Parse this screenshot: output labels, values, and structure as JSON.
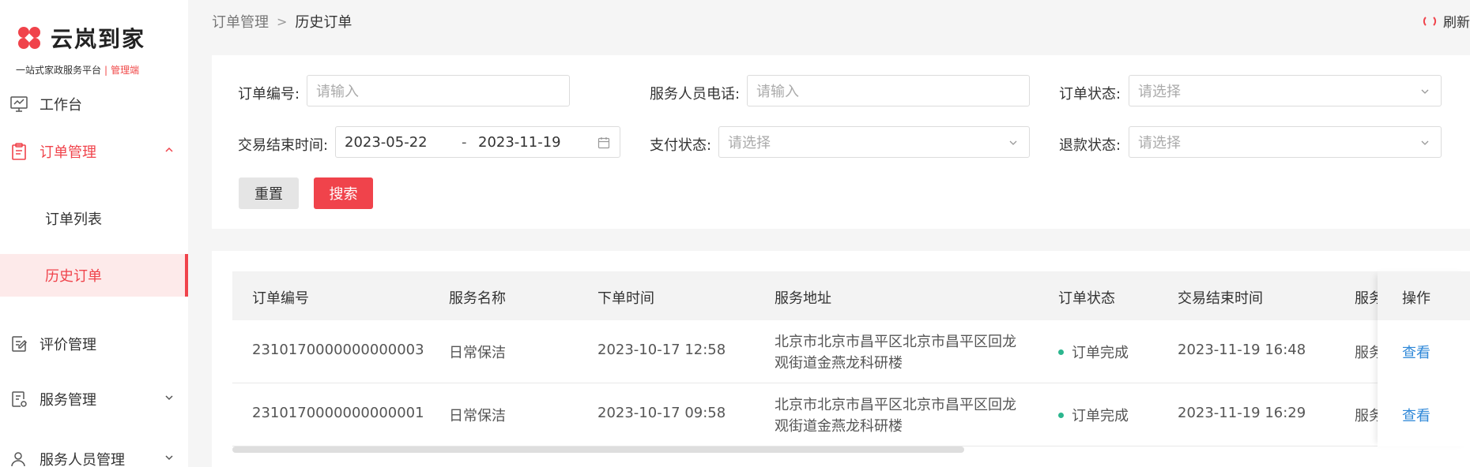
{
  "brand": {
    "name": "云岚到家",
    "tagline": "一站式家政服务平台",
    "separator": "|",
    "role": "管理端",
    "accent": "#f0434b"
  },
  "sidebar": {
    "items": [
      {
        "label": "工作台",
        "icon": "monitor-icon"
      },
      {
        "label": "订单管理",
        "icon": "clipboard-icon",
        "expanded": true
      },
      {
        "label": "订单列表"
      },
      {
        "label": "历史订单",
        "selected": true
      },
      {
        "label": "评价管理",
        "icon": "edit-doc-icon"
      },
      {
        "label": "服务管理",
        "icon": "settings-doc-icon"
      },
      {
        "label": "服务人员管理",
        "icon": "person-icon"
      }
    ]
  },
  "breadcrumb": {
    "parent": "订单管理",
    "separator": ">",
    "current": "历史订单"
  },
  "refresh_label": "刷新",
  "filters": {
    "order_no": {
      "label": "订单编号:",
      "placeholder": "请输入"
    },
    "staff_phone": {
      "label": "服务人员电话:",
      "placeholder": "请输入"
    },
    "order_status": {
      "label": "订单状态:",
      "placeholder": "请选择"
    },
    "trade_end_time": {
      "label": "交易结束时间:",
      "start": "2023-05-22",
      "separator": "-",
      "end": "2023-11-19"
    },
    "pay_status": {
      "label": "支付状态:",
      "placeholder": "请选择"
    },
    "refund_status": {
      "label": "退款状态:",
      "placeholder": "请选择"
    },
    "reset_label": "重置",
    "search_label": "搜索"
  },
  "table": {
    "columns": [
      "订单编号",
      "服务名称",
      "下单时间",
      "服务地址",
      "订单状态",
      "交易结束时间",
      "服务",
      "操作"
    ],
    "rows": [
      {
        "order_no": "2310170000000000003",
        "service_name": "日常保洁",
        "order_time": "2023-10-17 12:58",
        "address": "北京市北京市昌平区北京市昌平区回龙观街道金燕龙科研楼",
        "status": "订单完成",
        "end_time": "2023-11-19 16:48",
        "service_clip": "服务",
        "action": "查看"
      },
      {
        "order_no": "2310170000000000001",
        "service_name": "日常保洁",
        "order_time": "2023-10-17 09:58",
        "address": "北京市北京市昌平区北京市昌平区回龙观街道金燕龙科研楼",
        "status": "订单完成",
        "end_time": "2023-11-19 16:29",
        "service_clip": "服务",
        "action": "查看"
      }
    ]
  }
}
